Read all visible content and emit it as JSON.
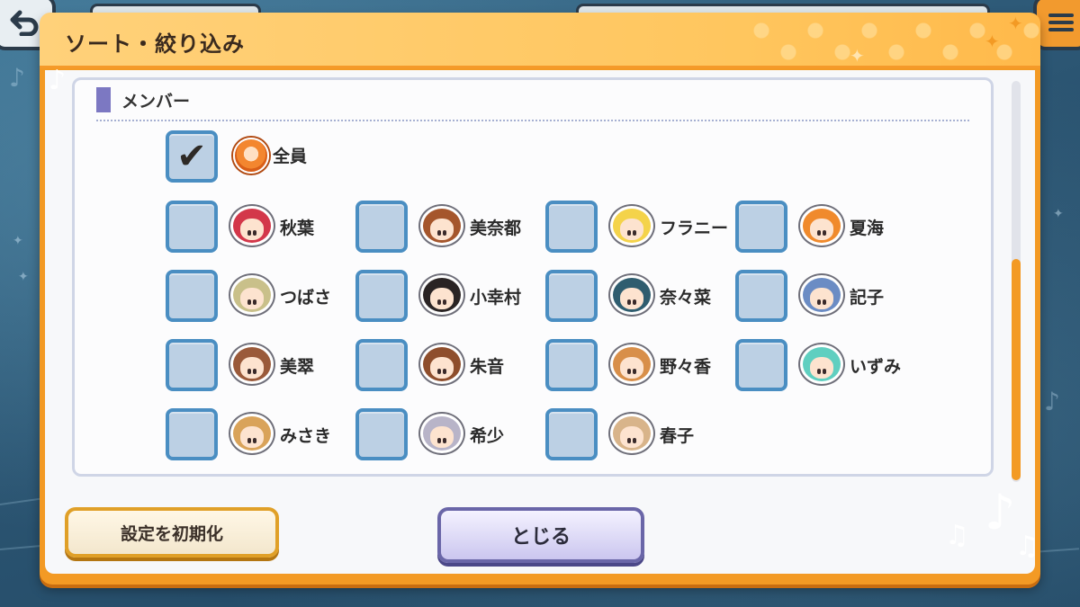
{
  "dialog": {
    "title": "ソート・絞り込み"
  },
  "section": {
    "label": "メンバー"
  },
  "all_option": {
    "label": "全員",
    "checked": true
  },
  "members": [
    {
      "name": "秋葉",
      "checked": false,
      "hair": "#d3374a"
    },
    {
      "name": "美奈都",
      "checked": false,
      "hair": "#a5562c"
    },
    {
      "name": "フラニー",
      "checked": false,
      "hair": "#f4d34a"
    },
    {
      "name": "夏海",
      "checked": false,
      "hair": "#f08a2c"
    },
    {
      "name": "つばさ",
      "checked": false,
      "hair": "#c9c08a"
    },
    {
      "name": "小幸村",
      "checked": false,
      "hair": "#2a2424"
    },
    {
      "name": "奈々菜",
      "checked": false,
      "hair": "#2f5d6f"
    },
    {
      "name": "記子",
      "checked": false,
      "hair": "#6b8cc4"
    },
    {
      "name": "美翠",
      "checked": false,
      "hair": "#9a5a3a"
    },
    {
      "name": "朱音",
      "checked": false,
      "hair": "#8e4e2c"
    },
    {
      "name": "野々香",
      "checked": false,
      "hair": "#d88f4a"
    },
    {
      "name": "いずみ",
      "checked": false,
      "hair": "#5fcfc0"
    },
    {
      "name": "みさき",
      "checked": false,
      "hair": "#d9a35a"
    },
    {
      "name": "希少",
      "checked": false,
      "hair": "#b8b4c8"
    },
    {
      "name": "春子",
      "checked": false,
      "hair": "#d8b48a"
    }
  ],
  "buttons": {
    "reset_label": "設定を初期化",
    "close_label": "とじる"
  },
  "scroll": {
    "position_fraction": 0.55
  },
  "icons": {
    "check": "checkmark-icon",
    "all": "all-members-icon",
    "music": "music-note-icon"
  },
  "colors": {
    "frame": "#f39a24",
    "checkbox_border": "#4a8ec2",
    "checkbox_fill": "#bcd0e4",
    "section_accent": "#7c78c2"
  }
}
